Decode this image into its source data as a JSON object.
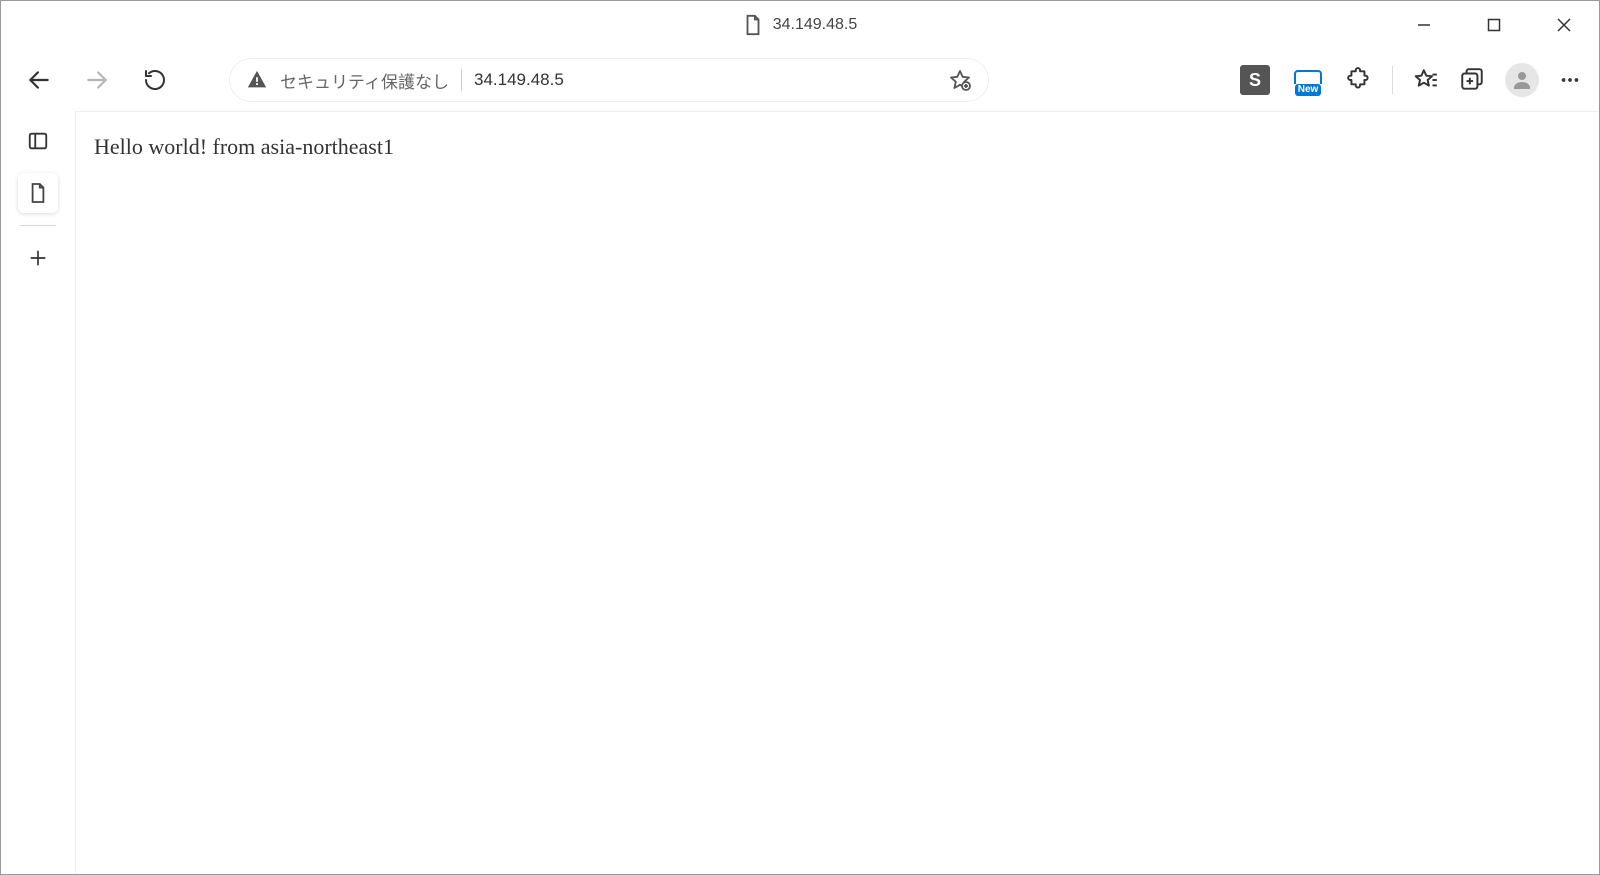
{
  "window": {
    "tab_title": "34.149.48.5",
    "controls": {
      "minimize": "minimize",
      "maximize": "maximize",
      "close": "close"
    }
  },
  "toolbar": {
    "security_label": "セキュリティ保護なし",
    "url": "34.149.48.5",
    "ext_s_label": "S",
    "ext_new_label": "New"
  },
  "page": {
    "body_text": "Hello world! from asia-northeast1"
  }
}
